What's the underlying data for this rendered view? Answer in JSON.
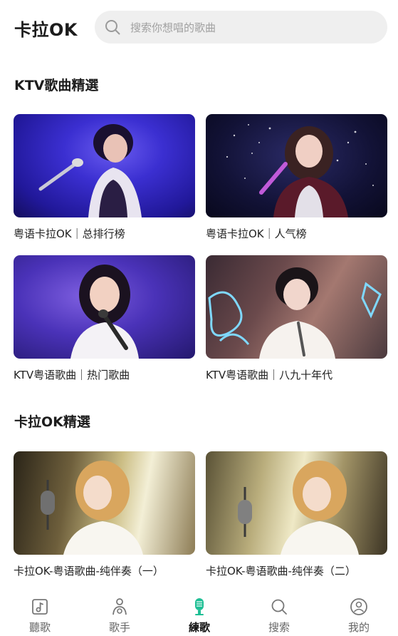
{
  "header": {
    "title": "卡拉OK",
    "search_placeholder": "搜索你想唱的歌曲"
  },
  "sections": [
    {
      "title": "KTV歌曲精選",
      "cards": [
        {
          "label": "粤语卡拉OK｜总排行榜"
        },
        {
          "label": "粤语卡拉OK｜人气榜"
        },
        {
          "label": "KTV粤语歌曲｜热门歌曲"
        },
        {
          "label": "KTV粤语歌曲｜八九十年代"
        }
      ]
    },
    {
      "title": "卡拉OK精選",
      "cards": [
        {
          "label": "卡拉OK-粤语歌曲-纯伴奏（一）"
        },
        {
          "label": "卡拉OK-粤语歌曲-纯伴奏（二）"
        }
      ]
    }
  ],
  "tabbar": {
    "active_index": 2,
    "accent": "#1fbf95",
    "items": [
      {
        "label": "聽歌",
        "icon": "music-note-icon"
      },
      {
        "label": "歌手",
        "icon": "singer-icon"
      },
      {
        "label": "練歌",
        "icon": "microphone-icon"
      },
      {
        "label": "搜索",
        "icon": "search-icon"
      },
      {
        "label": "我的",
        "icon": "profile-icon"
      }
    ]
  }
}
